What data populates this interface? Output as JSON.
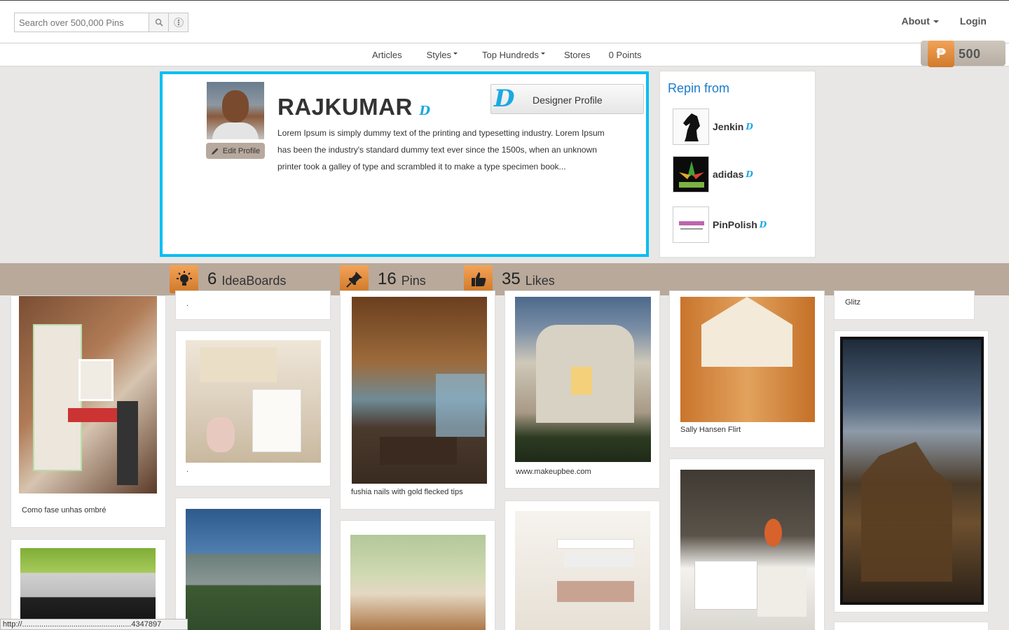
{
  "header": {
    "search_placeholder": "Search over 500,000 Pins",
    "about_label": "About",
    "login_label": "Login"
  },
  "subnav": {
    "articles": "Articles",
    "styles": "Styles",
    "top_hundreds": "Top Hundreds",
    "stores": "Stores",
    "points_text": "0 Points"
  },
  "points_badge": {
    "symbol": "₱",
    "value": "500"
  },
  "profile": {
    "name": "RAJKUMAR",
    "edit_label": "Edit Profile",
    "description": "Lorem Ipsum is simply dummy text of the printing and typesetting industry. Lorem Ipsum has been the industry's standard dummy text ever since the 1500s, when an unknown printer took a galley of type and scrambled it to make a type specimen book...",
    "designer_label": "Designer Profile",
    "badge_glyph": "D"
  },
  "repin": {
    "title": "Repin from",
    "items": [
      {
        "name": "Jenkin"
      },
      {
        "name": "adidas"
      },
      {
        "name": "PinPolish"
      }
    ]
  },
  "stats": [
    {
      "count": "6",
      "label": "IdeaBoards"
    },
    {
      "count": "16",
      "label": "Pins"
    },
    {
      "count": "35",
      "label": "Likes"
    }
  ],
  "pins": {
    "c1a": "Como fase unhas ombré",
    "c2a": ".",
    "c2b": ".",
    "c3a": "fushia nails with gold flecked tips",
    "c4a": "www.makeupbee.com",
    "c5a": "Sally Hansen Flirt",
    "c6a": "Glitz"
  },
  "status_url": "http://...................................................4347897",
  "colors": {
    "accent_blue": "#00bff3",
    "link_blue": "#1a7ccc",
    "orange": "#e08a3a",
    "stats_bar": "#b8a99b"
  }
}
